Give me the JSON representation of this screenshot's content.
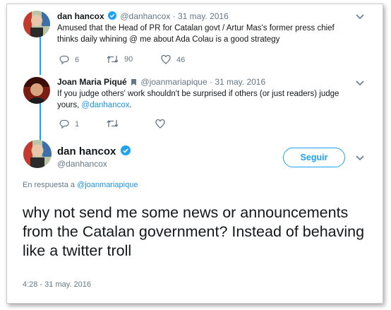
{
  "tweets": [
    {
      "name": "dan hancox",
      "handle": "@danhancox",
      "date": "· 31 may. 2016",
      "text": "Amused that the Head of PR for Catalan govt / Artur Mas's former press chief thinks daily whining @ me about Ada Colau is a good strategy",
      "replies": "6",
      "retweets": "90",
      "likes": "46"
    },
    {
      "name": "Joan Maria Piqué",
      "handle": "@joanmariapique",
      "date": "· 31 may. 2016",
      "text_before": "If you judge others' work shouldn't be surprised if others (or just readers) judge yours,",
      "text_link": "@danhancox",
      "text_after": ".",
      "replies": "1"
    }
  ],
  "main": {
    "name": "dan hancox",
    "handle": "@danhancox",
    "follow_label": "Seguir",
    "reply_prefix": "En respuesta a",
    "reply_to": "@joanmariapique",
    "text": "why not send me some news or announcements from the Catalan government? Instead of behaving like a twitter troll",
    "timestamp": "4:28 - 31 may. 2016"
  },
  "colors": {
    "accent": "#1da1f2",
    "muted": "#657786",
    "link": "#1b95e0"
  },
  "icons": [
    "reply-icon",
    "retweet-icon",
    "like-icon",
    "verified-icon",
    "chevron-down-icon"
  ]
}
